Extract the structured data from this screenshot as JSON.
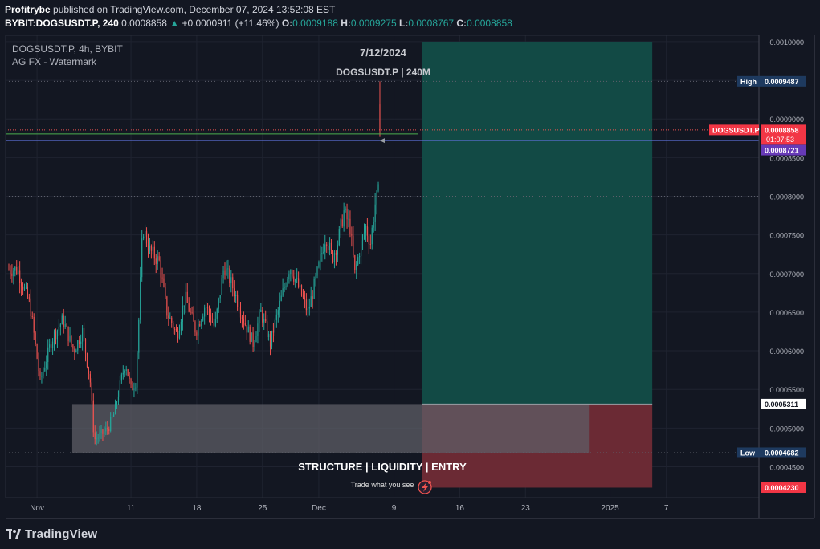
{
  "header": {
    "publisher": "Profitrybe",
    "published_text": " published on TradingView.com, December 07, 2024 13:52:08 EST",
    "symbol_line": "BYBIT:DOGSUSDT.P, 240",
    "last": "0.0008858",
    "change": "+0.0000911 (+11.46%)",
    "o_label": "O:",
    "o_value": "0.0009188",
    "h_label": "H:",
    "h_value": "0.0009275",
    "l_label": "L:",
    "l_value": "0.0008767",
    "c_label": "C:",
    "c_value": "0.0008858"
  },
  "legend": {
    "line1": "DOGSUSDT.P, 4h, BYBIT",
    "line2": "AG FX - Watermark"
  },
  "watermark": {
    "date": "7/12/2024",
    "symbol": "DOGSUSDT.P | 240M",
    "tagline": "STRUCTURE | LIQUIDITY | ENTRY",
    "slogan": "Trade what you see"
  },
  "price_labels": {
    "high_label": "High",
    "high_value": "0.0009487",
    "symbol_tag": "DOGSUSDT.P",
    "last_value": "0.0008858",
    "countdown": "01:07:53",
    "entry_value": "0.0008721",
    "box_top_value": "0.0005311",
    "low_label": "Low",
    "low_value": "0.0004682",
    "stop_value": "0.0004230"
  },
  "footer": {
    "brand": "TradingView"
  },
  "colors": {
    "background": "#131722",
    "up": "#26a69a",
    "down": "#ef5350",
    "target_zone": "#124a45",
    "stop_zone": "#6b2a34",
    "box": "#5d5e66",
    "entry_line": "#5b6fd6",
    "green_line": "#4caf50",
    "last_tag": "#f23645",
    "entry_tag": "#673ab7"
  },
  "chart_data": {
    "type": "candlestick",
    "symbol": "DOGSUSDT.P",
    "interval": "4h",
    "ylim": [
      0.00041,
      0.001002
    ],
    "y_ticks": [
      "0.0010000",
      "0.0009500",
      "0.0009000",
      "0.0008500",
      "0.0008000",
      "0.0007500",
      "0.0007000",
      "0.0006500",
      "0.0006000",
      "0.0005500",
      "0.0005000",
      "0.0004500"
    ],
    "x_ticks": [
      "Nov",
      "11",
      "18",
      "25",
      "Dec",
      "9",
      "16",
      "23",
      "2025",
      "7"
    ],
    "envelope": [
      [
        "Oct 29 22:00",
        0.000705
      ],
      [
        "Oct 31 06:00",
        0.00066
      ],
      [
        "Nov 1 08:00",
        0.00056
      ],
      [
        "Nov 2 14:00",
        0.000615
      ],
      [
        "Nov 3 18:00",
        0.00064
      ],
      [
        "Nov 4 22:00",
        0.0006
      ],
      [
        "Nov 5 20:00",
        0.000625
      ],
      [
        "Nov 6 16:00",
        0.00056
      ],
      [
        "Nov 7 02:00",
        0.000485
      ],
      [
        "Nov 7 22:00",
        0.000492
      ],
      [
        "Nov 8 14:00",
        0.0005
      ],
      [
        "Nov 9 06:00",
        0.00052
      ],
      [
        "Nov 9 22:00",
        0.00056
      ],
      [
        "Nov 10 10:00",
        0.000585
      ],
      [
        "Nov 11 00:00",
        0.00055
      ],
      [
        "Nov 11 12:00",
        0.00056
      ],
      [
        "Nov 11 20:00",
        0.00064
      ],
      [
        "Nov 12 06:00",
        0.00076
      ],
      [
        "Nov 13 00:00",
        0.00073
      ],
      [
        "Nov 14 00:00",
        0.000715
      ],
      [
        "Nov 14 20:00",
        0.00065
      ],
      [
        "Nov 15 22:00",
        0.00062
      ],
      [
        "Nov 16 18:00",
        0.00067
      ],
      [
        "Nov 17 22:00",
        0.000625
      ],
      [
        "Nov 18 22:00",
        0.00066
      ],
      [
        "Nov 19 22:00",
        0.00063
      ],
      [
        "Nov 20 22:00",
        0.00071
      ],
      [
        "Nov 21 22:00",
        0.00068
      ],
      [
        "Nov 23 00:00",
        0.00064
      ],
      [
        "Nov 24 00:00",
        0.00061
      ],
      [
        "Nov 24 20:00",
        0.00065
      ],
      [
        "Nov 25 20:00",
        0.00061
      ],
      [
        "Nov 26 20:00",
        0.00066
      ],
      [
        "Nov 27 22:00",
        0.00071
      ],
      [
        "Nov 28 22:00",
        0.00068
      ],
      [
        "Nov 29 20:00",
        0.00065
      ],
      [
        "Nov 30 20:00",
        0.0007
      ],
      [
        "Dec 1 18:00",
        0.00075
      ],
      [
        "Dec 2 10:00",
        0.00072
      ],
      [
        "Dec 3 00:00",
        0.00074
      ],
      [
        "Dec 3 16:00",
        0.00078
      ],
      [
        "Dec 4 08:00",
        0.00076
      ],
      [
        "Dec 4 20:00",
        0.0007
      ],
      [
        "Dec 5 10:00",
        0.000735
      ],
      [
        "Dec 6 00:00",
        0.00076
      ],
      [
        "Dec 6 12:00",
        0.00074
      ],
      [
        "Dec 7 00:00",
        0.00079
      ],
      [
        "Dec 7 08:00",
        0.000805
      ],
      [
        "Dec 7 12:00",
        0.00088
      ]
    ],
    "last_candle": {
      "time": "Dec 7 12:00",
      "open": 0.0009188,
      "high": 0.0009275,
      "low": 0.0008767,
      "close": 0.0008858
    },
    "price_levels": {
      "high": 0.0009487,
      "last": 0.0008858,
      "entry": 0.0008721,
      "box_top": 0.0005311,
      "low": 0.0004682,
      "stop": 0.000423
    },
    "demand_zone": {
      "from": "Nov 4 18:00",
      "to": "Dec 29 18:00",
      "top": 0.0005311,
      "bottom": 0.0004682
    },
    "position": {
      "from": "Dec 12 00:00",
      "to": "Jan 5 12:00",
      "entry": 0.0005311,
      "target": 0.001,
      "stop": 0.000423
    },
    "grid": true
  }
}
